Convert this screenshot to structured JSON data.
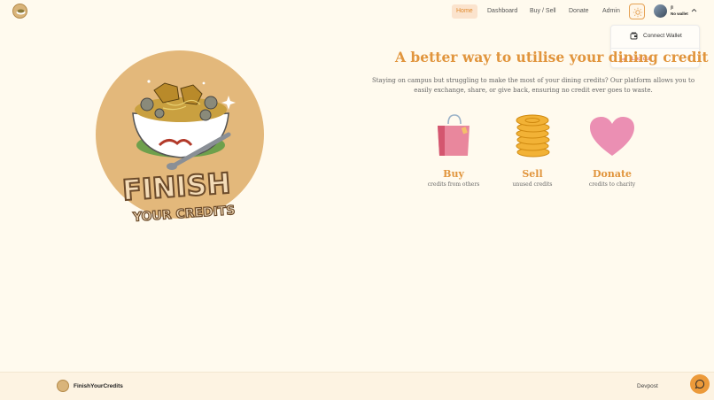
{
  "header": {
    "nav": [
      "Home",
      "Dashboard",
      "Buy / Sell",
      "Donate",
      "Admin"
    ],
    "active_index": 0,
    "user": {
      "name": "jli",
      "wallet_status": "No wallet"
    }
  },
  "dropdown": {
    "connect_label": "Connect Wallet",
    "logout_label": "Log out"
  },
  "hero": {
    "logo_line1": "FINISH",
    "logo_line2": "YOUR CREDITS",
    "headline": "A better way to utilise your dining credits",
    "subtext": "Staying on campus but struggling to make the most of your dining credits? Our platform allows you to easily exchange, share, or give back, ensuring no credit ever goes to waste.",
    "features": [
      {
        "title": "Buy",
        "subtitle": "credits from others",
        "icon": "shopping-bag-icon"
      },
      {
        "title": "Sell",
        "subtitle": "unused credits",
        "icon": "coin-stack-icon"
      },
      {
        "title": "Donate",
        "subtitle": "credits to charity",
        "icon": "heart-icon"
      }
    ]
  },
  "footer": {
    "brand": "FinishYourCredits",
    "link": "Devpost"
  },
  "colors": {
    "accent": "#e1953d",
    "background": "#fffaee",
    "logout": "#d9534f"
  }
}
